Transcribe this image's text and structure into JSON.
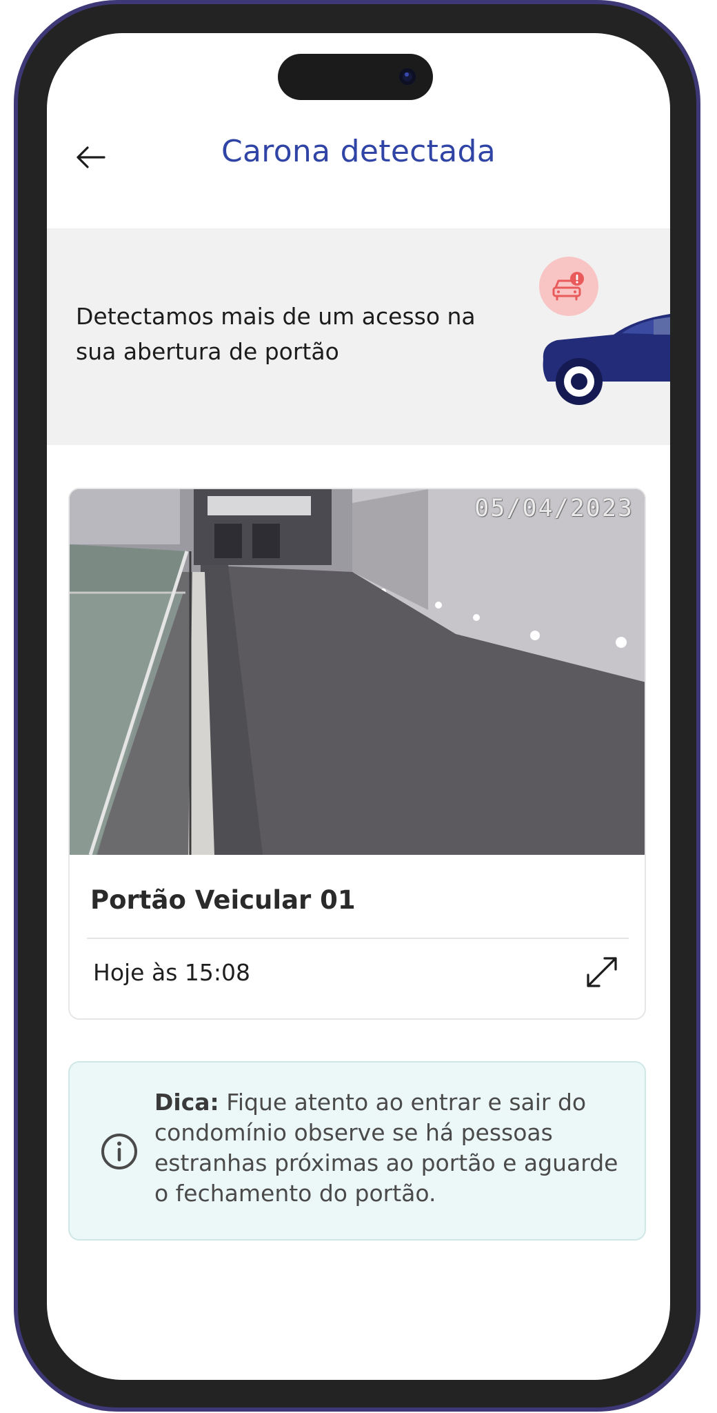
{
  "header": {
    "title": "Carona detectada",
    "back_icon": "arrow-left-icon"
  },
  "banner": {
    "message": "Detectamos mais de um acesso na sua abertura de portão",
    "badge_icon": "car-alert-icon",
    "illustration": "car-illustration"
  },
  "camera_card": {
    "timestamp": "05/04/2023",
    "gate_name": "Portão Veicular 01",
    "event_time": "Hoje às 15:08",
    "expand_icon": "expand-icon"
  },
  "tip": {
    "label": "Dica:",
    "text": "Fique atento ao entrar e sair do condomínio observe se há pessoas estranhas próximas ao portão e aguarde o fechamento do portão.",
    "icon": "info-icon"
  },
  "colors": {
    "title": "#2f44a5",
    "car": "#232c78",
    "badge_bg": "#f8c4c4",
    "badge_fg": "#e95a5a",
    "banner_bg": "#f1f1f1",
    "tip_bg": "#ecf8f7",
    "frame": "#3e3876"
  }
}
